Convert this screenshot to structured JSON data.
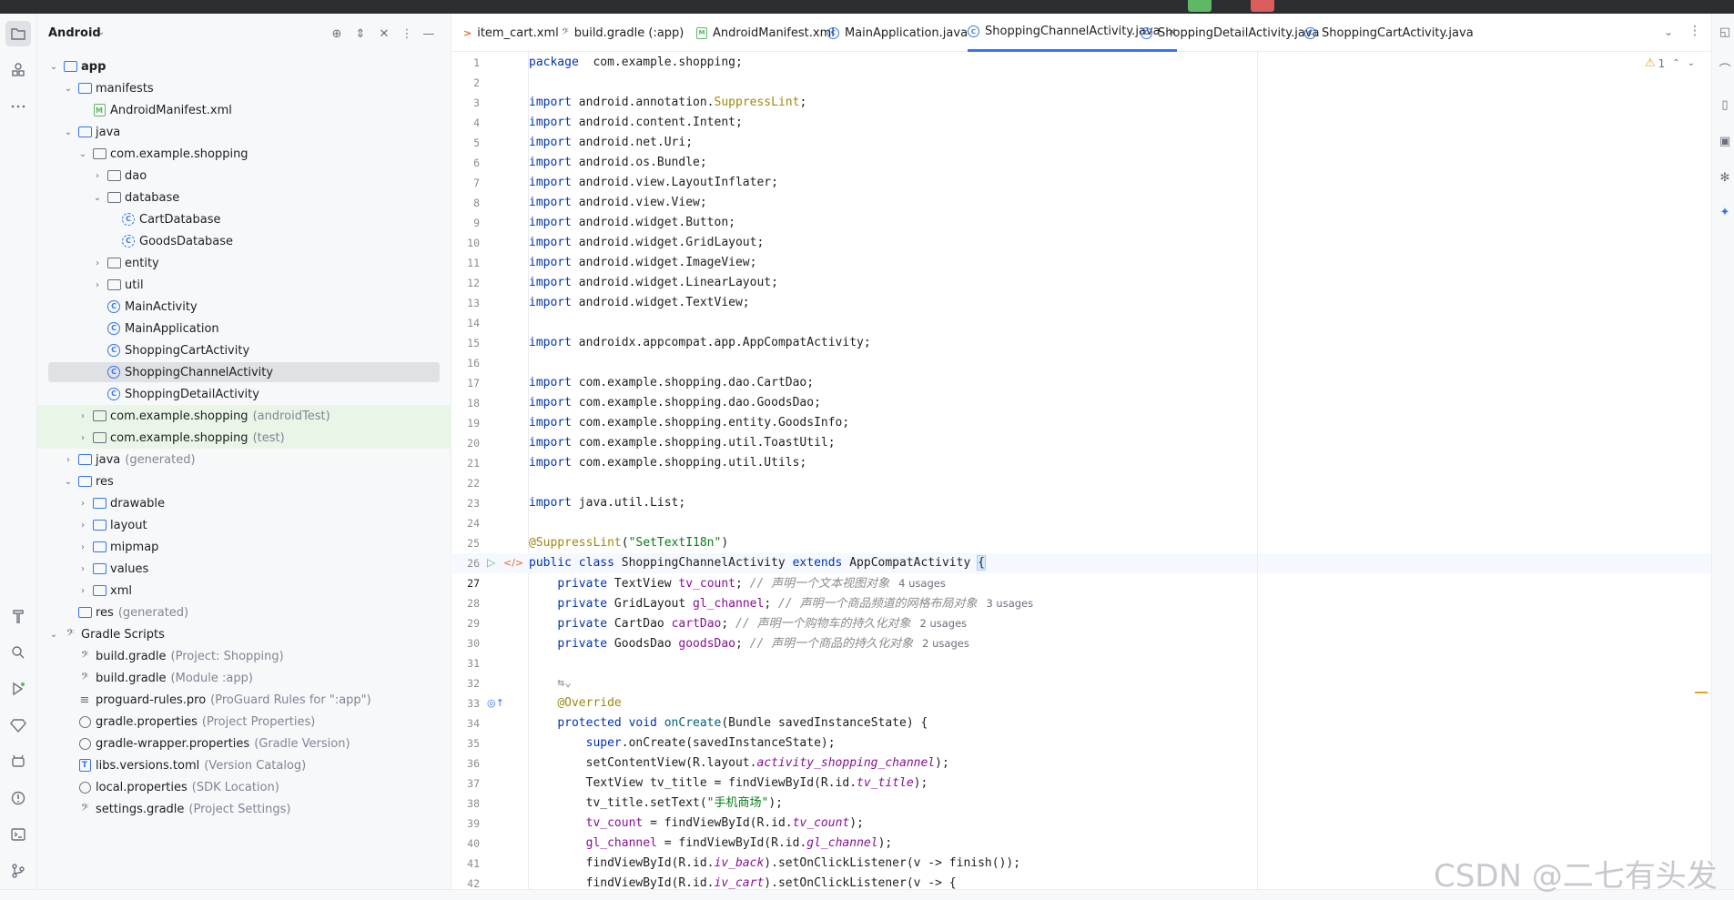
{
  "project_panel": {
    "title": "Android",
    "tree": [
      {
        "label": "app",
        "hint": "",
        "icon": "module-folder-icon",
        "bold": true,
        "expanded": true
      },
      {
        "label": "manifests",
        "hint": "",
        "icon": "folder-icon",
        "expanded": true
      },
      {
        "label": "AndroidManifest.xml",
        "hint": "",
        "icon": "manifest-icon"
      },
      {
        "label": "java",
        "hint": "",
        "icon": "folder-icon",
        "expanded": true
      },
      {
        "label": "com.example.shopping",
        "hint": "",
        "icon": "package-icon",
        "expanded": true
      },
      {
        "label": "dao",
        "hint": "",
        "icon": "package-icon",
        "expanded": false
      },
      {
        "label": "database",
        "hint": "",
        "icon": "package-icon",
        "expanded": true
      },
      {
        "label": "CartDatabase",
        "hint": "",
        "icon": "abstract-class-icon"
      },
      {
        "label": "GoodsDatabase",
        "hint": "",
        "icon": "abstract-class-icon"
      },
      {
        "label": "entity",
        "hint": "",
        "icon": "package-icon",
        "expanded": false
      },
      {
        "label": "util",
        "hint": "",
        "icon": "package-icon",
        "expanded": false
      },
      {
        "label": "MainActivity",
        "hint": "",
        "icon": "class-icon"
      },
      {
        "label": "MainApplication",
        "hint": "",
        "icon": "class-icon"
      },
      {
        "label": "ShoppingCartActivity",
        "hint": "",
        "icon": "class-icon"
      },
      {
        "label": "ShoppingChannelActivity",
        "hint": "",
        "icon": "class-icon",
        "selected": true
      },
      {
        "label": "ShoppingDetailActivity",
        "hint": "",
        "icon": "class-icon"
      },
      {
        "label": "com.example.shopping",
        "hint": "(androidTest)",
        "icon": "package-icon",
        "expanded": false,
        "test": true
      },
      {
        "label": "com.example.shopping",
        "hint": "(test)",
        "icon": "package-icon",
        "expanded": false,
        "test": true
      },
      {
        "label": "java",
        "hint": "(generated)",
        "icon": "folder-icon",
        "expanded": false
      },
      {
        "label": "res",
        "hint": "",
        "icon": "folder-icon",
        "expanded": true
      },
      {
        "label": "drawable",
        "hint": "",
        "icon": "folder-icon",
        "expanded": false
      },
      {
        "label": "layout",
        "hint": "",
        "icon": "folder-icon",
        "expanded": false
      },
      {
        "label": "mipmap",
        "hint": "",
        "icon": "folder-icon",
        "expanded": false
      },
      {
        "label": "values",
        "hint": "",
        "icon": "folder-icon",
        "expanded": false
      },
      {
        "label": "xml",
        "hint": "",
        "icon": "folder-icon",
        "expanded": false
      },
      {
        "label": "res",
        "hint": "(generated)",
        "icon": "folder-icon"
      },
      {
        "label": "Gradle Scripts",
        "hint": "",
        "icon": "gradle-icon",
        "expanded": true
      },
      {
        "label": "build.gradle",
        "hint": "(Project: Shopping)",
        "icon": "gradle-icon"
      },
      {
        "label": "build.gradle",
        "hint": "(Module :app)",
        "icon": "gradle-icon"
      },
      {
        "label": "proguard-rules.pro",
        "hint": "(ProGuard Rules for \":app\")",
        "icon": "text-file-icon"
      },
      {
        "label": "gradle.properties",
        "hint": "(Project Properties)",
        "icon": "settings-icon"
      },
      {
        "label": "gradle-wrapper.properties",
        "hint": "(Gradle Version)",
        "icon": "settings-icon"
      },
      {
        "label": "libs.versions.toml",
        "hint": "(Version Catalog)",
        "icon": "toml-icon"
      },
      {
        "label": "local.properties",
        "hint": "(SDK Location)",
        "icon": "settings-icon"
      },
      {
        "label": "settings.gradle",
        "hint": "(Project Settings)",
        "icon": "gradle-icon"
      }
    ]
  },
  "tabs": [
    {
      "label": "item_cart.xml",
      "icon": "xml-icon"
    },
    {
      "label": "build.gradle (:app)",
      "icon": "gradle-icon"
    },
    {
      "label": "AndroidManifest.xml",
      "icon": "manifest-icon"
    },
    {
      "label": "MainApplication.java",
      "icon": "class-icon"
    },
    {
      "label": "ShoppingChannelActivity.java",
      "icon": "class-icon",
      "active": true
    },
    {
      "label": "ShoppingDetailActivity.java",
      "icon": "class-icon"
    },
    {
      "label": "ShoppingCartActivity.java",
      "icon": "class-icon"
    }
  ],
  "warnings": {
    "count": "1"
  },
  "editor": {
    "current_line": 26,
    "lines": [
      {
        "n": "",
        "t": [
          [
            "kw",
            "package"
          ],
          [
            "",
            "  com.example.shopping;"
          ]
        ]
      },
      {
        "n": "1",
        "t": []
      },
      {
        "n": "2",
        "t": [
          [
            "kw",
            "import"
          ],
          [
            "",
            " android.annotation."
          ],
          [
            "ann",
            "SuppressLint"
          ],
          [
            "",
            ";"
          ]
        ]
      },
      {
        "n": "3",
        "t": [
          [
            "kw",
            "import"
          ],
          [
            "",
            " android.content.Intent;"
          ]
        ]
      },
      {
        "n": "4",
        "t": [
          [
            "kw",
            "import"
          ],
          [
            "",
            " android.net.Uri;"
          ]
        ]
      },
      {
        "n": "5",
        "t": [
          [
            "kw",
            "import"
          ],
          [
            "",
            " android.os.Bundle;"
          ]
        ]
      },
      {
        "n": "6",
        "t": [
          [
            "kw",
            "import"
          ],
          [
            "",
            " android.view.LayoutInflater;"
          ]
        ]
      },
      {
        "n": "7",
        "t": [
          [
            "kw",
            "import"
          ],
          [
            "",
            " android.view.View;"
          ]
        ]
      },
      {
        "n": "8",
        "t": [
          [
            "kw",
            "import"
          ],
          [
            "",
            " android.widget.Button;"
          ]
        ]
      },
      {
        "n": "9",
        "t": [
          [
            "kw",
            "import"
          ],
          [
            "",
            " android.widget.GridLayout;"
          ]
        ]
      },
      {
        "n": "10",
        "t": [
          [
            "kw",
            "import"
          ],
          [
            "",
            " android.widget.ImageView;"
          ]
        ]
      },
      {
        "n": "11",
        "t": [
          [
            "kw",
            "import"
          ],
          [
            "",
            " android.widget.LinearLayout;"
          ]
        ]
      },
      {
        "n": "12",
        "t": [
          [
            "kw",
            "import"
          ],
          [
            "",
            " android.widget.TextView;"
          ]
        ]
      },
      {
        "n": "13",
        "t": []
      },
      {
        "n": "14",
        "t": [
          [
            "kw",
            "import"
          ],
          [
            "",
            " androidx.appcompat.app.AppCompatActivity;"
          ]
        ]
      },
      {
        "n": "15",
        "t": []
      },
      {
        "n": "16",
        "t": [
          [
            "kw",
            "import"
          ],
          [
            "",
            " com.example.shopping.dao.CartDao;"
          ]
        ]
      },
      {
        "n": "17",
        "t": [
          [
            "kw",
            "import"
          ],
          [
            "",
            " com.example.shopping.dao.GoodsDao;"
          ]
        ]
      },
      {
        "n": "18",
        "t": [
          [
            "kw",
            "import"
          ],
          [
            "",
            " com.example.shopping.entity.GoodsInfo;"
          ]
        ]
      },
      {
        "n": "19",
        "t": [
          [
            "kw",
            "import"
          ],
          [
            "",
            " com.example.shopping.util.ToastUtil;"
          ]
        ]
      },
      {
        "n": "20",
        "t": [
          [
            "kw",
            "import"
          ],
          [
            "",
            " com.example.shopping.util.Utils;"
          ]
        ]
      },
      {
        "n": "21",
        "t": []
      },
      {
        "n": "22",
        "t": [
          [
            "kw",
            "import"
          ],
          [
            "",
            " java.util.List;"
          ]
        ]
      },
      {
        "n": "23",
        "t": []
      },
      {
        "n": "24",
        "t": [
          [
            "ann",
            "@SuppressLint"
          ],
          [
            "",
            "("
          ],
          [
            "str",
            "\"SetTextI18n\""
          ],
          [
            "",
            ")"
          ]
        ]
      },
      {
        "n": "25",
        "t": [
          [
            "kw",
            "public class"
          ],
          [
            "",
            " ShoppingChannelActivity "
          ],
          [
            "kw",
            "extends"
          ],
          [
            "",
            " AppCompatActivity "
          ],
          [
            "brace",
            "{"
          ]
        ]
      },
      {
        "n": "26",
        "t": [
          [
            "",
            "    "
          ],
          [
            "kw",
            "private"
          ],
          [
            "",
            " TextView "
          ],
          [
            "fld",
            "tv_count"
          ],
          [
            "",
            "; "
          ],
          [
            "cmt",
            "// 声明一个文本视图对象"
          ],
          [
            "usages",
            "4 usages"
          ]
        ]
      },
      {
        "n": "27",
        "t": [
          [
            "",
            "    "
          ],
          [
            "kw",
            "private"
          ],
          [
            "",
            " GridLayout "
          ],
          [
            "fld",
            "gl_channel"
          ],
          [
            "",
            "; "
          ],
          [
            "cmt",
            "// 声明一个商品频道的网格布局对象"
          ],
          [
            "usages",
            "3 usages"
          ]
        ]
      },
      {
        "n": "28",
        "t": [
          [
            "",
            "    "
          ],
          [
            "kw",
            "private"
          ],
          [
            "",
            " CartDao "
          ],
          [
            "fld",
            "cartDao"
          ],
          [
            "",
            "; "
          ],
          [
            "cmt",
            "// 声明一个购物车的持久化对象"
          ],
          [
            "usages",
            "2 usages"
          ]
        ]
      },
      {
        "n": "29",
        "t": [
          [
            "",
            "    "
          ],
          [
            "kw",
            "private"
          ],
          [
            "",
            " GoodsDao "
          ],
          [
            "fld",
            "goodsDao"
          ],
          [
            "",
            "; "
          ],
          [
            "cmt",
            "// 声明一个商品的持久化对象"
          ],
          [
            "usages",
            "2 usages"
          ]
        ]
      },
      {
        "n": "30",
        "t": []
      },
      {
        "n": "31",
        "t": [
          [
            "cmt",
            "    ⇆⌄"
          ]
        ]
      },
      {
        "n": "32",
        "t": [
          [
            "",
            "    "
          ],
          [
            "ann",
            "@Override"
          ]
        ]
      },
      {
        "n": "33",
        "t": [
          [
            "",
            "    "
          ],
          [
            "kw",
            "protected void"
          ],
          [
            "",
            " "
          ],
          [
            "mth",
            "onCreate"
          ],
          [
            "",
            "(Bundle savedInstanceState) {"
          ]
        ]
      },
      {
        "n": "34",
        "t": [
          [
            "",
            "        "
          ],
          [
            "kw",
            "super"
          ],
          [
            "",
            ".onCreate(savedInstanceState);"
          ]
        ]
      },
      {
        "n": "35",
        "t": [
          [
            "",
            "        setContentView(R.layout."
          ],
          [
            "ital",
            "activity_shopping_channel"
          ],
          [
            "",
            ");"
          ]
        ]
      },
      {
        "n": "36",
        "t": [
          [
            "",
            "        TextView tv_title = findViewById(R.id."
          ],
          [
            "ital",
            "tv_title"
          ],
          [
            "",
            ");"
          ]
        ]
      },
      {
        "n": "37",
        "t": [
          [
            "",
            "        tv_title.setText("
          ],
          [
            "str",
            "\"手机商场\""
          ],
          [
            "",
            ");"
          ]
        ]
      },
      {
        "n": "38",
        "t": [
          [
            "",
            "        "
          ],
          [
            "fld",
            "tv_count"
          ],
          [
            "",
            " = findViewById(R.id."
          ],
          [
            "ital",
            "tv_count"
          ],
          [
            "",
            ");"
          ]
        ]
      },
      {
        "n": "39",
        "t": [
          [
            "",
            "        "
          ],
          [
            "fld",
            "gl_channel"
          ],
          [
            "",
            " = findViewById(R.id."
          ],
          [
            "ital",
            "gl_channel"
          ],
          [
            "",
            ");"
          ]
        ]
      },
      {
        "n": "40",
        "t": [
          [
            "",
            "        findViewById(R.id."
          ],
          [
            "ital",
            "iv_back"
          ],
          [
            "",
            ").setOnClickListener(v -> finish());"
          ]
        ]
      },
      {
        "n": "41",
        "t": [
          [
            "",
            "        findViewById(R.id."
          ],
          [
            "ital",
            "iv_cart"
          ],
          [
            "",
            ").setOnClickListener(v -> {"
          ]
        ]
      }
    ]
  },
  "watermark": "CSDN @二七有头发",
  "colors": {
    "accent": "#3574f0",
    "keyword": "#0033b3",
    "annotation": "#9e880d",
    "string": "#067d17",
    "field": "#871094",
    "comment": "#8c8c8c"
  }
}
